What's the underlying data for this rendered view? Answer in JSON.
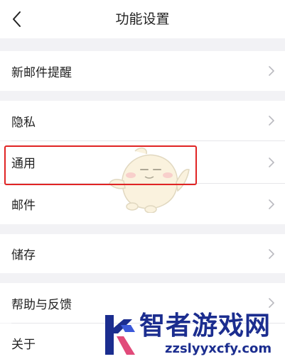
{
  "header": {
    "title": "功能设置",
    "back_icon": "chevron-left-icon"
  },
  "settings": {
    "items": [
      {
        "label": "新邮件提醒"
      },
      {
        "label": "隐私"
      },
      {
        "label": "通用"
      },
      {
        "label": "邮件"
      },
      {
        "label": "储存"
      },
      {
        "label": "帮助与反馈"
      },
      {
        "label": "关于"
      }
    ]
  },
  "overlay": {
    "highlight_color": "#e02424",
    "watermark_name": "智者游戏网",
    "watermark_url": "zzslyyxcfy.com"
  }
}
